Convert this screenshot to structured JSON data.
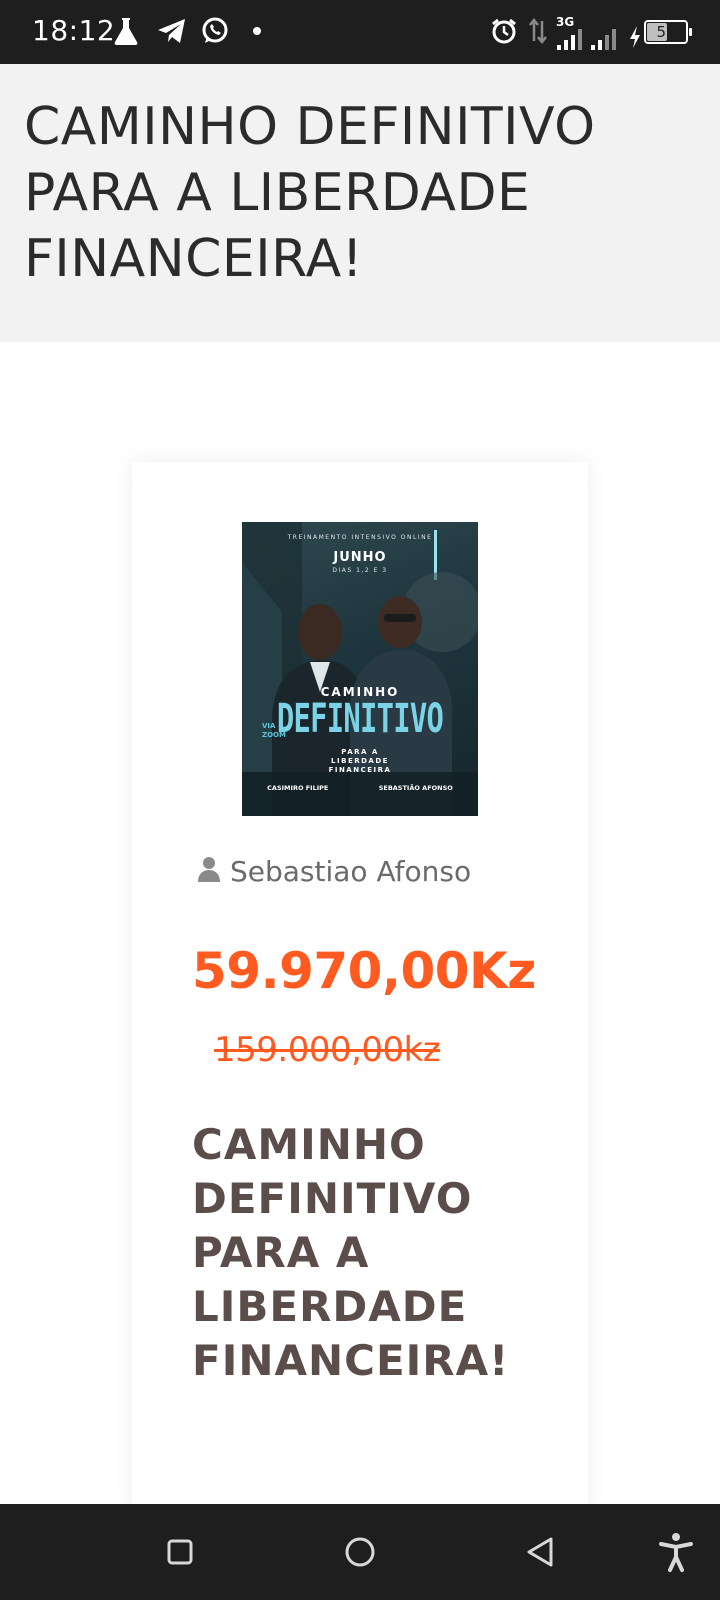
{
  "status_bar": {
    "time": "18:12",
    "network_label": "3G",
    "battery_level": "51",
    "battery_fraction": 0.51,
    "icons": [
      "flask-icon",
      "telegram-icon",
      "whatsapp-icon",
      "dot-icon",
      "alarm-icon",
      "data-transfer-icon",
      "signal-icon",
      "signal-icon",
      "charging-icon",
      "battery-icon"
    ]
  },
  "header": {
    "title": "CAMINHO DEFINITIVO PARA A LIBERDADE FINANCEIRA!"
  },
  "product": {
    "poster": {
      "top_text": "TREINAMENTO INTENSIVO ONLINE",
      "month": "JUNHO",
      "days": "DIAS 1,2 E 3",
      "word1": "CAMINHO",
      "word2": "DEFINITIVO",
      "subtitle": "PARA A LIBERDADE FINANCEIRA",
      "via": "VIA ZOOM",
      "name_left": "CASIMIRO FILIPE",
      "name_right": "SEBASTIÃO AFONSO"
    },
    "author": "Sebastiao Afonso",
    "price": "59.970,00Kz",
    "old_price": "159.000,00kz",
    "title": "CAMINHO DEFINITIVO PARA A LIBERDADE FINANCEIRA!"
  },
  "colors": {
    "accent": "#ff5a1f",
    "title_text": "#5b4d4a",
    "header_bg": "#f3f2f3",
    "bars": "#1e1e1e"
  },
  "nav_bar": {
    "icons": [
      "recent-apps-icon",
      "home-icon",
      "back-icon",
      "accessibility-icon"
    ]
  }
}
